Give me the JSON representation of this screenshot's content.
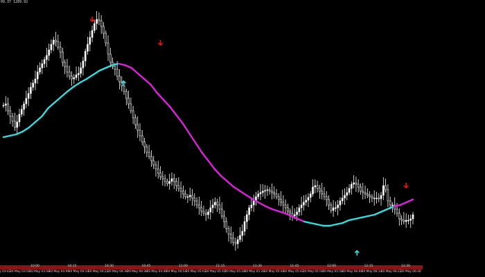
{
  "info_text": "09.37  1289.92",
  "colors": {
    "background": "#000000",
    "candle": "#ffffff",
    "ma_up": "#33dde0",
    "ma_down": "#dd22dd",
    "arrow_sell": "#ee1111",
    "arrow_buy": "#33dde0",
    "timebar": "#8c1414"
  },
  "time_axis_labels": [
    "10:00",
    "10:15",
    "10:30",
    "10:45",
    "11:00",
    "11:15",
    "11:30",
    "11:45",
    "12:00",
    "12:15",
    "12:30"
  ],
  "date_labels": [
    "20 May 03:42",
    "20 May 03:50",
    "20 May 03:58",
    "20 May 04:06",
    "20 May 04:14",
    "20 May 04:22",
    "20 May 04:30",
    "20 May 04:38",
    "20 May 04:46",
    "20 May 04:54",
    "20 May 05:02",
    "20 May 05:10",
    "20 May 05:18",
    "20 May 05:26",
    "20 May 05:34",
    "20 May 05:42",
    "20 May 05:50",
    "20 May 05:58",
    "20 May 06:06",
    "20 May 06:14",
    "20 May 06:22",
    "20 May 06:30"
  ],
  "series_closes": [
    152,
    150,
    160,
    168,
    175,
    184,
    176,
    165,
    158,
    150,
    142,
    135,
    126,
    120,
    114,
    104,
    98,
    92,
    86,
    80,
    72,
    64,
    58,
    60,
    68,
    75,
    90,
    96,
    104,
    110,
    114,
    112,
    108,
    106,
    98,
    88,
    74,
    64,
    54,
    44,
    34,
    28,
    30,
    38,
    48,
    62,
    78,
    90,
    96,
    100,
    110,
    118,
    124,
    132,
    142,
    150,
    160,
    170,
    180,
    188,
    196,
    205,
    212,
    220,
    226,
    232,
    238,
    244,
    250,
    255,
    258,
    262,
    265,
    262,
    258,
    262,
    268,
    272,
    276,
    280,
    284,
    284,
    282,
    286,
    290,
    296,
    300,
    305,
    308,
    310,
    306,
    300,
    296,
    292,
    296,
    302,
    312,
    320,
    330,
    338,
    344,
    350,
    352,
    346,
    340,
    334,
    320,
    310,
    300,
    296,
    290,
    284,
    280,
    278,
    276,
    275,
    274,
    276,
    278,
    280,
    284,
    288,
    292,
    296,
    300,
    305,
    308,
    312,
    310,
    306,
    300,
    296,
    292,
    289,
    285,
    280,
    270,
    268,
    272,
    276,
    280,
    284,
    288,
    296,
    304,
    300,
    300,
    296,
    290,
    286,
    282,
    278,
    272,
    266,
    264,
    266,
    270,
    276,
    278,
    280,
    282,
    284,
    286,
    286,
    286,
    287,
    282,
    268,
    274,
    290,
    296,
    296,
    302,
    308,
    316,
    318,
    320,
    318,
    318,
    316,
    310
  ],
  "ma_values": [
    198,
    196,
    194,
    190,
    184,
    176,
    168,
    156,
    148,
    140,
    132,
    125,
    119,
    114,
    108,
    102,
    98,
    94,
    92,
    94,
    98,
    106,
    114,
    122,
    134,
    144,
    154,
    166,
    178,
    192,
    206,
    220,
    232,
    244,
    254,
    262,
    270,
    276,
    282,
    288,
    293,
    298,
    302,
    305,
    308,
    312,
    316,
    320,
    322,
    324,
    326,
    326,
    324,
    322,
    318,
    316,
    314,
    312,
    310,
    306,
    302,
    298,
    296,
    292,
    288
  ],
  "ma_colors": [
    "up",
    "up",
    "up",
    "up",
    "up",
    "up",
    "up",
    "up",
    "up",
    "up",
    "up",
    "up",
    "up",
    "up",
    "up",
    "up",
    "up",
    "up",
    "down",
    "down",
    "down",
    "down",
    "down",
    "down",
    "down",
    "down",
    "down",
    "down",
    "down",
    "down",
    "down",
    "down",
    "down",
    "down",
    "down",
    "down",
    "down",
    "down",
    "down",
    "down",
    "down",
    "down",
    "down",
    "down",
    "down",
    "down",
    "down",
    "up",
    "up",
    "up",
    "up",
    "up",
    "up",
    "up",
    "up",
    "up",
    "up",
    "up",
    "up",
    "up",
    "up",
    "down",
    "down",
    "down",
    "down"
  ],
  "arrows": [
    {
      "type": "sell",
      "bar": 65
    },
    {
      "type": "buy",
      "bar": 88
    },
    {
      "type": "sell",
      "bar": 115
    },
    {
      "type": "buy",
      "bar": 259
    },
    {
      "type": "sell",
      "bar": 295
    }
  ]
}
